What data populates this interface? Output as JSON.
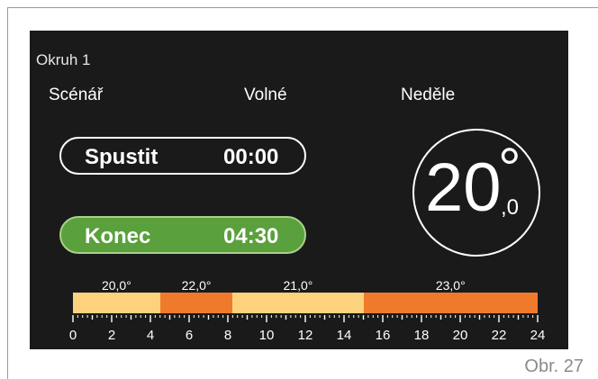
{
  "circuit": "Okruh 1",
  "header": {
    "scenario_label": "Scénář",
    "mode_label": "Volné",
    "day_label": "Neděle"
  },
  "start": {
    "label": "Spustit",
    "time": "00:00"
  },
  "end": {
    "label": "Konec",
    "time": "04:30"
  },
  "temperature": {
    "integer": "20",
    "degree": "°",
    "decimal": ",0"
  },
  "schedule": {
    "segments": [
      {
        "label": "20,0°",
        "from": 0,
        "to": 4.5,
        "color": "#fcd27d"
      },
      {
        "label": "22,0°",
        "from": 4.5,
        "to": 8.25,
        "color": "#f07a2c"
      },
      {
        "label": "21,0°",
        "from": 8.25,
        "to": 15,
        "color": "#fcd27d"
      },
      {
        "label": "23,0°",
        "from": 15,
        "to": 24,
        "color": "#f07a2c"
      }
    ],
    "hour_labels": [
      "0",
      "2",
      "4",
      "6",
      "8",
      "10",
      "12",
      "14",
      "16",
      "18",
      "20",
      "22",
      "24"
    ]
  },
  "figure_label": "Obr. 27"
}
